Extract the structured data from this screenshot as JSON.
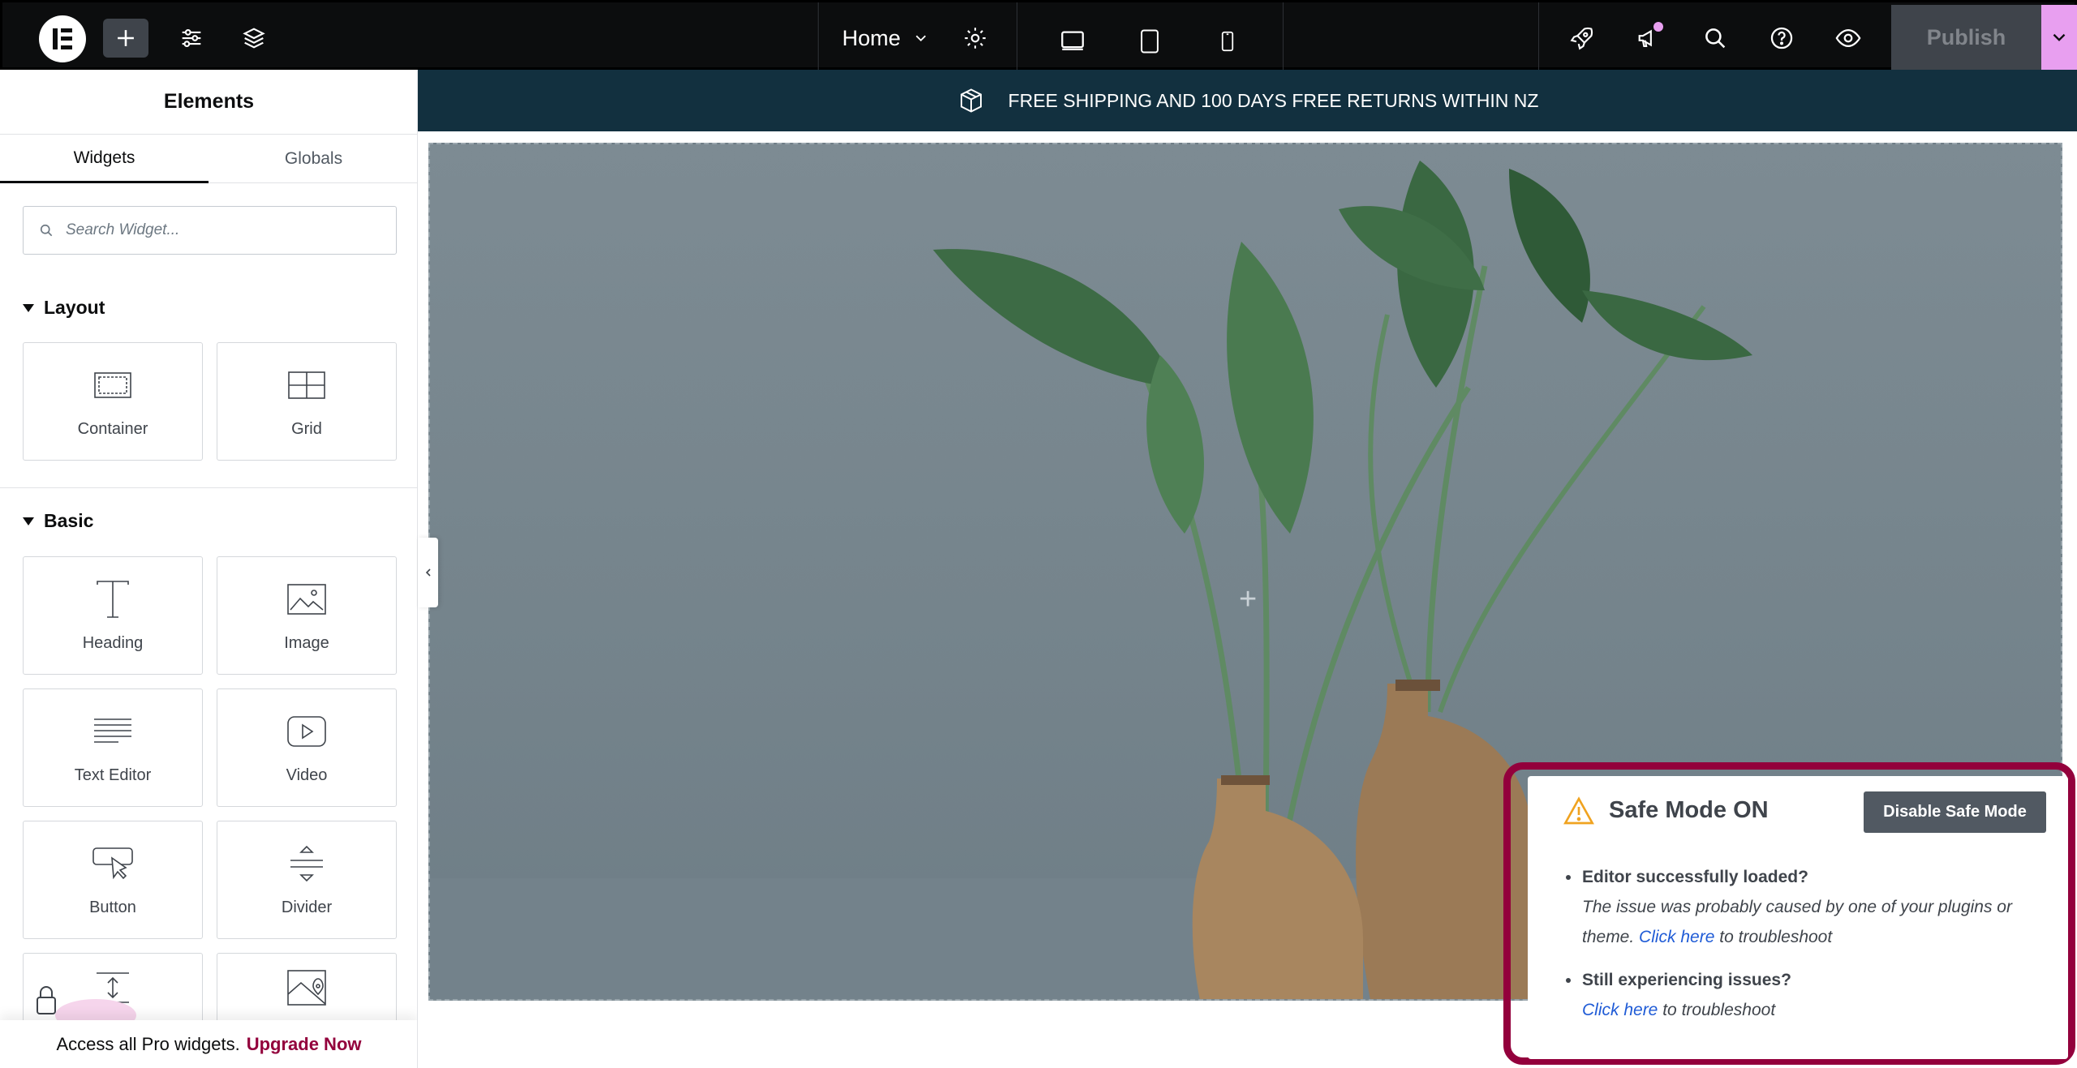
{
  "topbar": {
    "page_name": "Home",
    "publish_label": "Publish",
    "colors": {
      "background": "#0c0d0e",
      "accent": "#e89ff0"
    }
  },
  "panel": {
    "title": "Elements",
    "tabs": [
      {
        "label": "Widgets",
        "active": true
      },
      {
        "label": "Globals",
        "active": false
      }
    ],
    "search_placeholder": "Search Widget...",
    "categories": [
      {
        "label": "Layout",
        "widgets": [
          "Container",
          "Grid"
        ]
      },
      {
        "label": "Basic",
        "widgets": [
          "Heading",
          "Image",
          "Text Editor",
          "Video",
          "Button",
          "Divider"
        ]
      }
    ],
    "pro_bar": {
      "text": "Access all Pro widgets.",
      "link": "Upgrade Now"
    }
  },
  "canvas": {
    "announcement": "FREE SHIPPING AND 100 DAYS FREE RETURNS WITHIN NZ"
  },
  "safe_mode": {
    "title": "Safe Mode ON",
    "button": "Disable Safe Mode",
    "items": [
      {
        "question": "Editor successfully loaded?",
        "description": "The issue was probably caused by one of your plugins or theme.",
        "link": "Click here",
        "suffix": "to troubleshoot"
      },
      {
        "question": "Still experiencing issues?",
        "link": "Click here",
        "suffix": "to troubleshoot"
      }
    ],
    "accent_color": "#93003c"
  }
}
